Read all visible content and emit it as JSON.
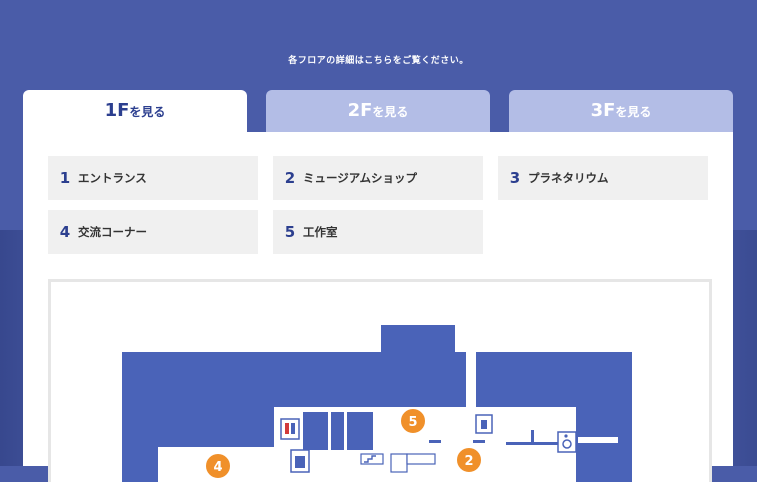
{
  "intro": "各フロアの詳細はこちらをご覧ください。",
  "tabs": [
    {
      "num": "1F",
      "suffix": "を見る",
      "active": true
    },
    {
      "num": "2F",
      "suffix": "を見る",
      "active": false
    },
    {
      "num": "3F",
      "suffix": "を見る",
      "active": false
    }
  ],
  "areas": [
    {
      "num": "1",
      "label": "エントランス"
    },
    {
      "num": "2",
      "label": "ミュージアムショップ"
    },
    {
      "num": "3",
      "label": "プラネタリウム"
    },
    {
      "num": "4",
      "label": "交流コーナー"
    },
    {
      "num": "5",
      "label": "工作室"
    }
  ],
  "map": {
    "markers": [
      "5",
      "2",
      "4"
    ],
    "colors": {
      "floor": "#4a63b8",
      "marker": "#f0902a",
      "frame": "#e6e6e6"
    }
  },
  "icons": [
    "restroom-icon",
    "elevator-icon",
    "locker-icon",
    "stairs-icon",
    "wheelchair-icon"
  ]
}
